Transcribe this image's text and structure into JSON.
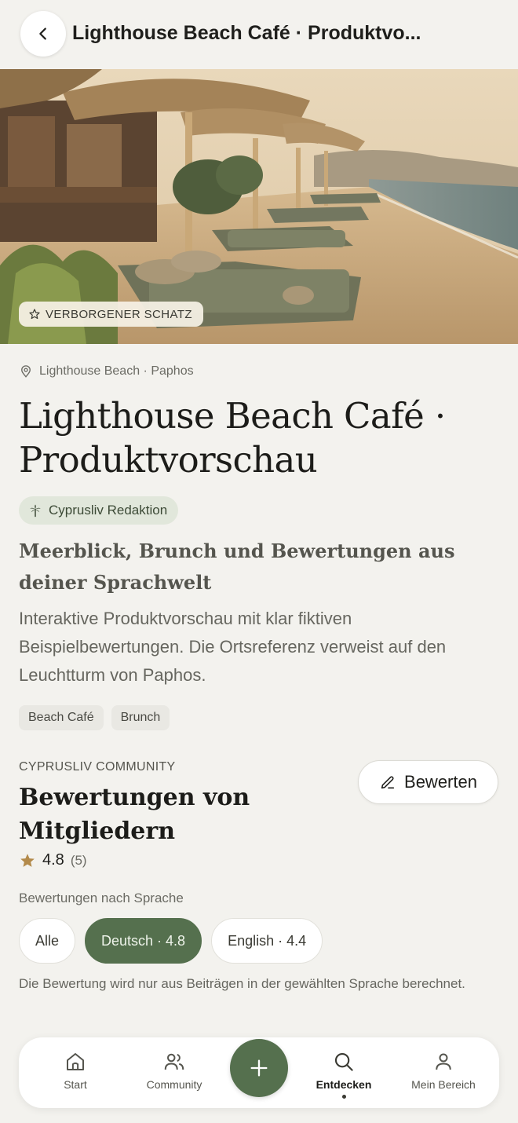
{
  "header": {
    "title": "Lighthouse Beach Café · Produktvo..."
  },
  "hero": {
    "badge": "VERBORGENER SCHATZ"
  },
  "place": {
    "location": "Lighthouse Beach · Paphos",
    "title_line1": "Lighthouse Beach Café ·",
    "title_line2": "Produktvorschau",
    "editor_badge": "Cyprusliv Redaktion",
    "subtitle": "Meerblick, Brunch und Bewertungen aus deiner Sprachwelt",
    "description": "Interaktive Produktvorschau mit klar fiktiven Beispielbewertungen. Die Ortsreferenz verweist auf den Leuchtturm von Paphos.",
    "tags": [
      "Beach Café",
      "Brunch"
    ]
  },
  "reviews": {
    "section_label": "CYPRUSLIV COMMUNITY",
    "title_line1": "Bewertungen von",
    "title_line2": "Mitgliedern",
    "rating": "4.8",
    "count": "(5)",
    "review_button": "Bewerten",
    "language_label": "Bewertungen nach Sprache",
    "languages": [
      {
        "label": "Alle",
        "active": false
      },
      {
        "label": "Deutsch · 4.8",
        "active": true
      },
      {
        "label": "English · 4.4",
        "active": false
      }
    ],
    "note": "Die Bewertung wird nur aus Beiträgen in der gewählten Sprache berechnet."
  },
  "nav": {
    "items": [
      {
        "label": "Start",
        "icon": "home-icon"
      },
      {
        "label": "Community",
        "icon": "users-icon"
      },
      {
        "label": "Entdecken",
        "icon": "search-icon",
        "active": true
      },
      {
        "label": "Mein Bereich",
        "icon": "user-icon"
      }
    ],
    "fab_icon": "plus-icon"
  },
  "colors": {
    "accent": "#55704e",
    "background": "#f3f2ee",
    "star": "#b38a4a"
  }
}
